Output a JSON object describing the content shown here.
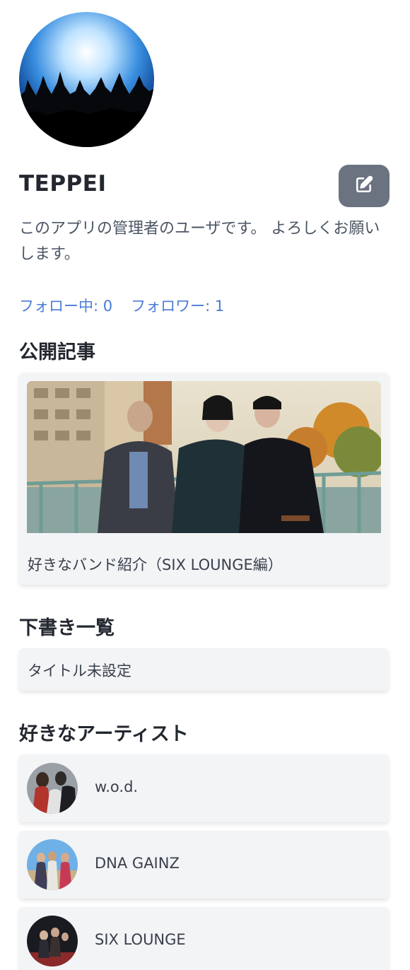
{
  "profile": {
    "username": "TEPPEI",
    "bio": "このアプリの管理者のユーザです。 よろしくお願いします。",
    "following_label": "フォロー中: 0",
    "followers_label": "フォロワー: 1"
  },
  "sections": {
    "published_title": "公開記事",
    "drafts_title": "下書き一覧",
    "artists_title": "好きなアーティスト"
  },
  "published_articles": [
    {
      "title": "好きなバンド紹介（SIX LOUNGE編）"
    }
  ],
  "drafts": [
    {
      "title": "タイトル未設定"
    }
  ],
  "artists": [
    {
      "name": "w.o.d."
    },
    {
      "name": "DNA GAINZ"
    },
    {
      "name": "SIX LOUNGE"
    }
  ],
  "icons": {
    "edit": "edit-icon"
  },
  "colors": {
    "link": "#4a7bd6",
    "edit_button": "#6b7280",
    "card_bg": "#f3f4f6"
  }
}
